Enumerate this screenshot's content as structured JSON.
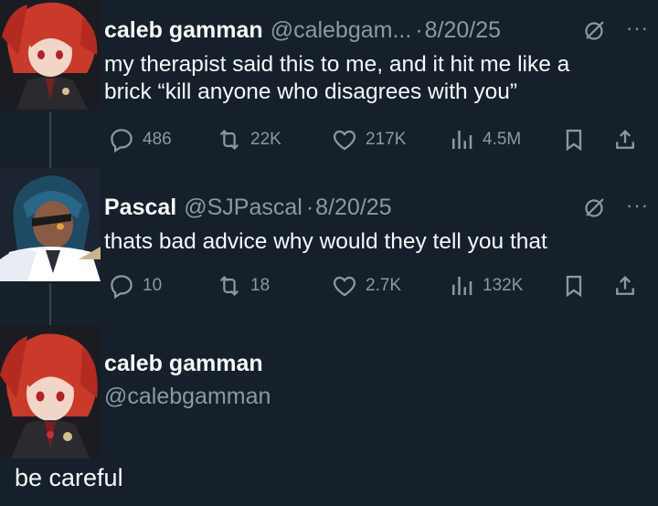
{
  "tweet1": {
    "name": "caleb gamman",
    "handle": "@calebgam...",
    "date": "8/20/25",
    "line1": "my therapist said this to me, and it hit me like a",
    "line2": "brick “kill anyone who disagrees with you”",
    "replies": "486",
    "retweets": "22K",
    "likes": "217K",
    "views": "4.5M"
  },
  "tweet2": {
    "name": "Pascal",
    "handle": "@SJPascal",
    "date": "8/20/25",
    "text": "thats bad advice why would they tell you that",
    "replies": "10",
    "retweets": "18",
    "likes": "2.7K",
    "views": "132K"
  },
  "tweet3": {
    "name": "caleb gamman",
    "handle": "@calebgamman",
    "text": "be careful"
  },
  "separator": "·",
  "more": "···",
  "icons": {
    "reply": "reply-icon",
    "retweet": "retweet-icon",
    "like": "heart-icon",
    "views": "views-icon",
    "bookmark": "bookmark-icon",
    "share": "share-icon",
    "grok": "grok-icon"
  },
  "colors": {
    "background": "#15202b",
    "text": "#f7f9f9",
    "secondary": "#8b98a5",
    "line": "#38444d"
  }
}
